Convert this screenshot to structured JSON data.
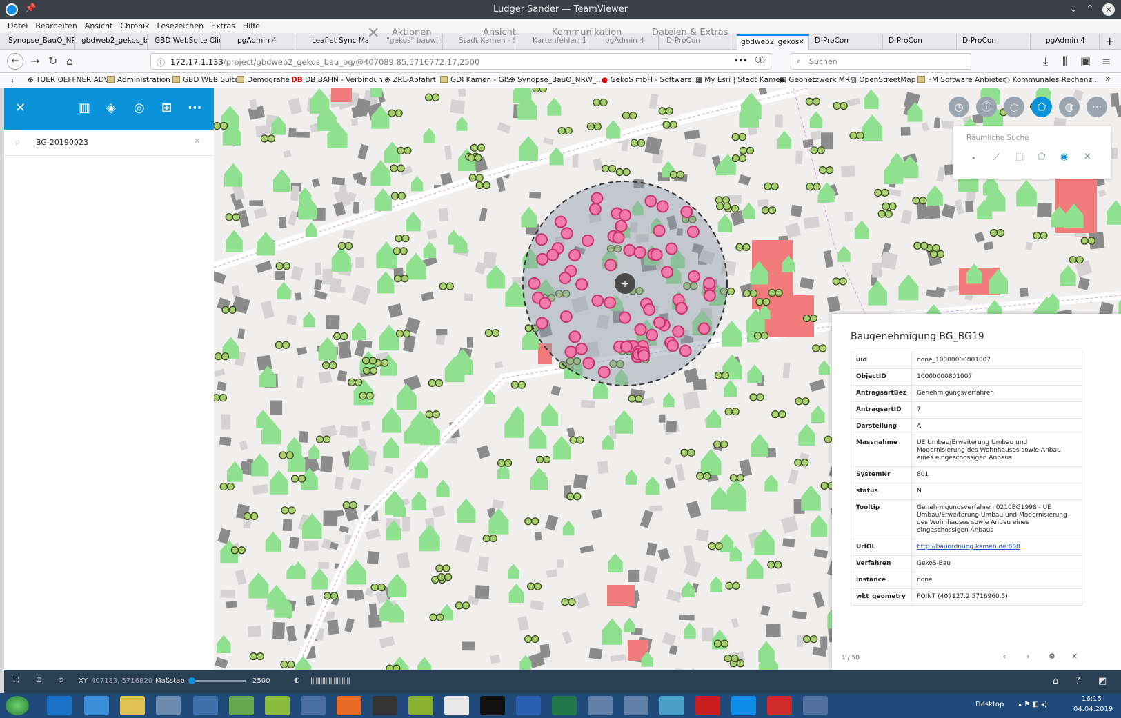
{
  "window": {
    "title": "Ludger Sander — TeamViewer"
  },
  "menu": [
    "Datei",
    "Bearbeiten",
    "Ansicht",
    "Chronik",
    "Lesezeichen",
    "Extras",
    "Hilfe"
  ],
  "teamviewer_toolbar": [
    "Aktionen",
    "Ansicht",
    "Kommunikation",
    "Dateien & Extras"
  ],
  "tabs": [
    "Synopse_BauO_NRW",
    "gbdweb2_gekos_ba",
    "GBD WebSuite Clien",
    "pgAdmin 4",
    "Leaflet Sync Ma",
    "\"gekos\" bauwin",
    "Stadt Kamen - S",
    "Kartenfehler: 15",
    "pgAdmin 4",
    "D-ProCon",
    "gbdweb2_gekos",
    "D-ProCon",
    "D-ProCon",
    "D-ProCon",
    "pgAdmin 4"
  ],
  "address": {
    "url_host": "172.17.1.133",
    "url_path": "/project/gbdweb2_gekos_bau_pg/@407089.85,5716772.17,2500",
    "search_placeholder": "Suchen"
  },
  "bookmarks": [
    "TUER OEFFNER ADV",
    "Administration",
    "GBD WEB Suite",
    "Demografie",
    "DB BAHN - Verbindun...",
    "ZRL-Abfahrt",
    "GDI Kamen - GIS",
    "Synopse_BauO_NRW_...",
    "GekoS mbH - Software...",
    "My Esri | Stadt Kamen",
    "Geonetzwerk MR",
    "OpenStreetMap",
    "FM Software Anbieter",
    "Kommunales Rechenz..."
  ],
  "sidebar": {
    "search_value": "BG-20190023"
  },
  "spatial_search": {
    "title": "Räumliche Suche"
  },
  "info": {
    "title": "Baugenehmigung BG_BG19",
    "rows": [
      {
        "k": "uid",
        "v": "none_10000000801007"
      },
      {
        "k": "ObjectID",
        "v": "10000000801007"
      },
      {
        "k": "AntragsartBez",
        "v": "Genehmigungsverfahren"
      },
      {
        "k": "AntragsartID",
        "v": "7"
      },
      {
        "k": "Darstellung",
        "v": "A"
      },
      {
        "k": "Massnahme",
        "v": "UE Umbau/Erweiterung Umbau und Modernisierung des Wohnhauses sowie Anbau eines eingeschossigen Anbaus"
      },
      {
        "k": "SystemNr",
        "v": "801"
      },
      {
        "k": "status",
        "v": "N"
      },
      {
        "k": "Tooltip",
        "v": "Genehmigungsverfahren 0210BG1998 - UE Umbau/Erweiterung Umbau und Modernisierung des Wohnhauses sowie Anbau eines eingeschossigen Anbaus"
      },
      {
        "k": "UrlOL",
        "v": "http://bauordnung.kamen.de:808",
        "link": true
      },
      {
        "k": "Verfahren",
        "v": "GekoS-Bau"
      },
      {
        "k": "instance",
        "v": "none"
      },
      {
        "k": "wkt_geometry",
        "v": "POINT (407127.2 5716960.5)"
      }
    ],
    "pager": "1 / 50"
  },
  "statusbar": {
    "xy_label": "XY",
    "xy_value": "407183, 5716820",
    "scale_label": "Maßstab",
    "scale_value": "2500"
  },
  "taskbar": {
    "desktop": "Desktop",
    "time": "16:15",
    "date": "04.04.2019"
  },
  "colors": {
    "header_blue": "#0b93d9",
    "tree_green": "#8fe08f",
    "red_building": "#f07575",
    "marker_pink": "#c8326e"
  }
}
